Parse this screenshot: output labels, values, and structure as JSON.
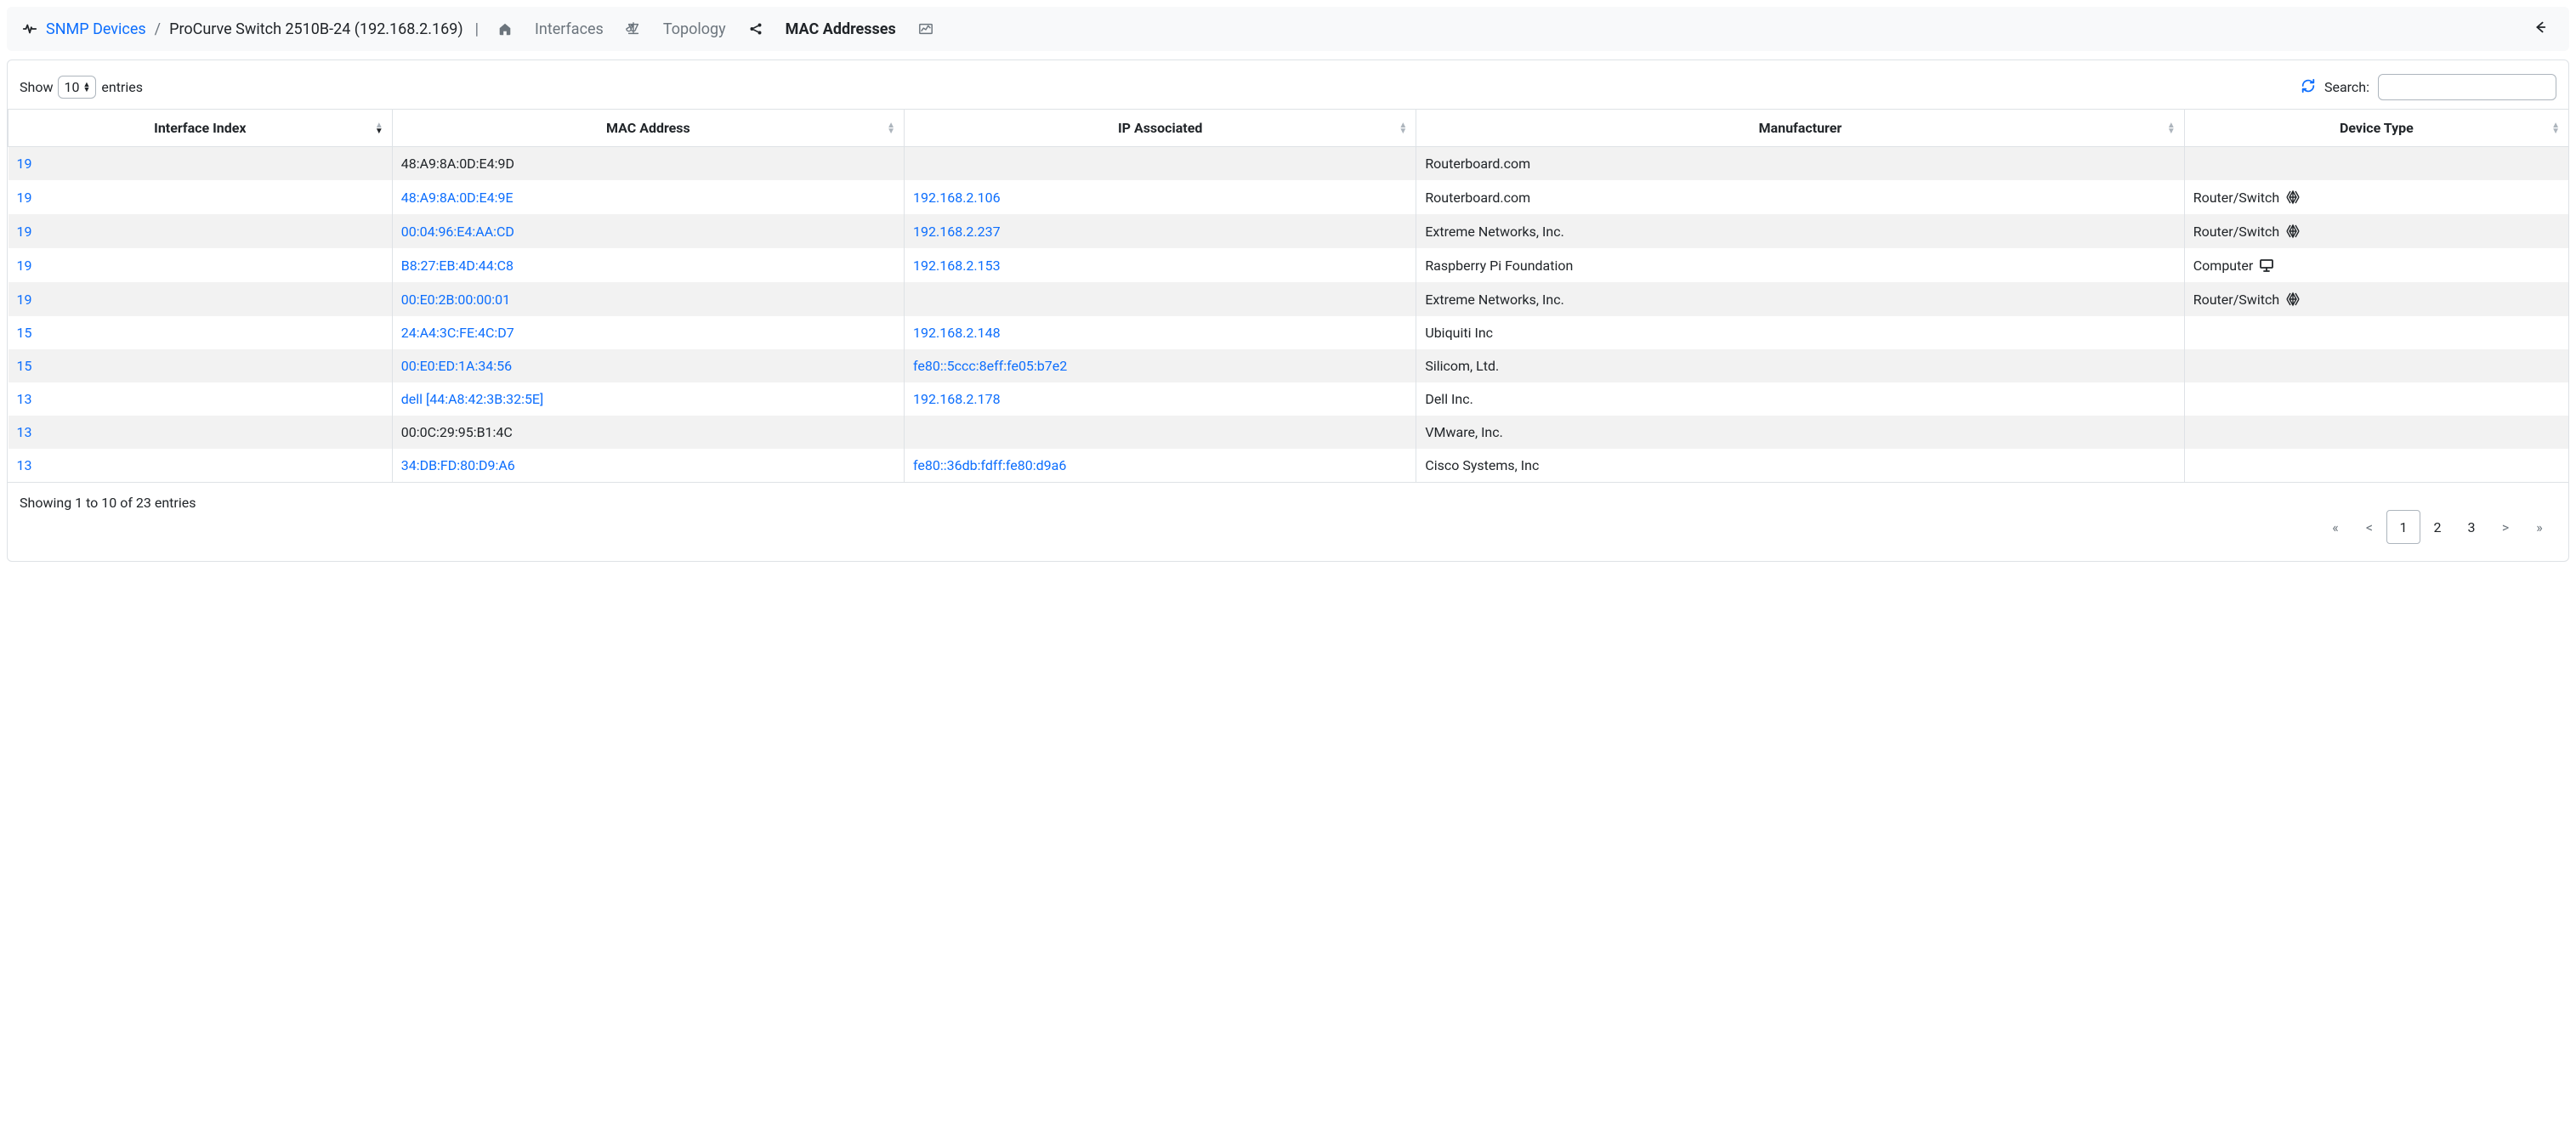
{
  "breadcrumb": {
    "root": "SNMP Devices",
    "sep": "/",
    "current": "ProCurve Switch 2510B-24 (192.168.2.169)"
  },
  "tabs": {
    "interfaces": "Interfaces",
    "topology": "Topology",
    "mac": "MAC Addresses"
  },
  "controls": {
    "show_label": "Show",
    "entries_label": "entries",
    "page_size": "10",
    "search_label": "Search:",
    "search_value": ""
  },
  "columns": {
    "iface": "Interface Index",
    "mac": "MAC Address",
    "ip": "IP Associated",
    "manu": "Manufacturer",
    "dtype": "Device Type"
  },
  "rows": [
    {
      "iface": "19",
      "mac": "48:A9:8A:0D:E4:9D",
      "mac_link": false,
      "ip": "",
      "manu": "Routerboard.com",
      "dtype": "",
      "dicon": ""
    },
    {
      "iface": "19",
      "mac": "48:A9:8A:0D:E4:9E",
      "mac_link": true,
      "ip": "192.168.2.106",
      "manu": "Routerboard.com",
      "dtype": "Router/Switch",
      "dicon": "net"
    },
    {
      "iface": "19",
      "mac": "00:04:96:E4:AA:CD",
      "mac_link": true,
      "ip": "192.168.2.237",
      "manu": "Extreme Networks, Inc.",
      "dtype": "Router/Switch",
      "dicon": "net"
    },
    {
      "iface": "19",
      "mac": "B8:27:EB:4D:44:C8",
      "mac_link": true,
      "ip": "192.168.2.153",
      "manu": "Raspberry Pi Foundation",
      "dtype": "Computer",
      "dicon": "computer"
    },
    {
      "iface": "19",
      "mac": "00:E0:2B:00:00:01",
      "mac_link": true,
      "ip": "",
      "manu": "Extreme Networks, Inc.",
      "dtype": "Router/Switch",
      "dicon": "net"
    },
    {
      "iface": "15",
      "mac": "24:A4:3C:FE:4C:D7",
      "mac_link": true,
      "ip": "192.168.2.148",
      "manu": "Ubiquiti Inc",
      "dtype": "",
      "dicon": ""
    },
    {
      "iface": "15",
      "mac": "00:E0:ED:1A:34:56",
      "mac_link": true,
      "ip": "fe80::5ccc:8eff:fe05:b7e2",
      "manu": "Silicom, Ltd.",
      "dtype": "",
      "dicon": ""
    },
    {
      "iface": "13",
      "mac": "dell [44:A8:42:3B:32:5E]",
      "mac_link": true,
      "ip": "192.168.2.178",
      "manu": "Dell Inc.",
      "dtype": "",
      "dicon": ""
    },
    {
      "iface": "13",
      "mac": "00:0C:29:95:B1:4C",
      "mac_link": false,
      "ip": "",
      "manu": "VMware, Inc.",
      "dtype": "",
      "dicon": ""
    },
    {
      "iface": "13",
      "mac": "34:DB:FD:80:D9:A6",
      "mac_link": true,
      "ip": "fe80::36db:fdff:fe80:d9a6",
      "manu": "Cisco Systems, Inc",
      "dtype": "",
      "dicon": ""
    }
  ],
  "footer": {
    "info": "Showing 1 to 10 of 23 entries"
  },
  "pagination": {
    "first": "«",
    "prev": "<",
    "p1": "1",
    "p2": "2",
    "p3": "3",
    "next": ">",
    "last": "»"
  }
}
